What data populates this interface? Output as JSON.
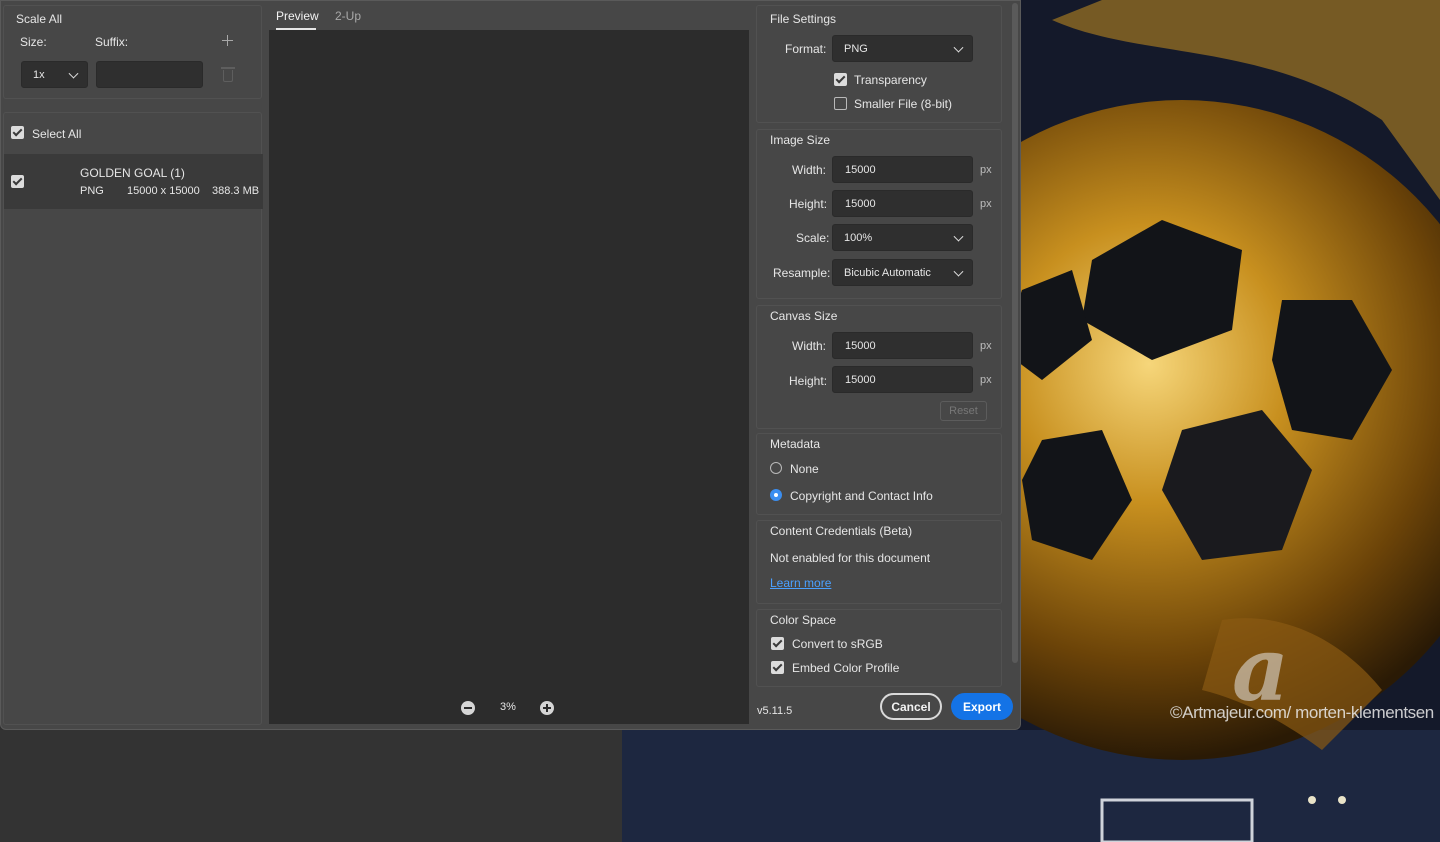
{
  "left": {
    "scale_all_label": "Scale All",
    "size_label": "Size:",
    "suffix_label": "Suffix:",
    "size_value": "1x",
    "suffix_value": "",
    "select_all_label": "Select All",
    "file": {
      "name": "GOLDEN GOAL (1)",
      "format": "PNG",
      "dimensions": "15000 x 15000",
      "size": "388.3 MB"
    }
  },
  "preview": {
    "tabs": [
      "Preview",
      "2-Up"
    ],
    "zoom": "3%"
  },
  "settings": {
    "file_settings": {
      "title": "File Settings",
      "format_label": "Format:",
      "format_value": "PNG",
      "transparency_label": "Transparency",
      "smaller_file_label": "Smaller File (8-bit)"
    },
    "image_size": {
      "title": "Image Size",
      "width_label": "Width:",
      "width_value": "15000",
      "height_label": "Height:",
      "height_value": "15000",
      "scale_label": "Scale:",
      "scale_value": "100%",
      "resample_label": "Resample:",
      "resample_value": "Bicubic Automatic",
      "unit": "px"
    },
    "canvas_size": {
      "title": "Canvas Size",
      "width_label": "Width:",
      "width_value": "15000",
      "height_label": "Height:",
      "height_value": "15000",
      "unit": "px",
      "reset_label": "Reset"
    },
    "metadata": {
      "title": "Metadata",
      "option_none": "None",
      "option_copyright": "Copyright and Contact Info"
    },
    "content_credentials": {
      "title": "Content Credentials (Beta)",
      "status": "Not enabled for this document",
      "learn_more": "Learn more"
    },
    "color_space": {
      "title": "Color Space",
      "convert_label": "Convert to sRGB",
      "embed_label": "Embed Color Profile"
    }
  },
  "footer": {
    "version": "v5.11.5",
    "cancel_label": "Cancel",
    "export_label": "Export"
  },
  "background": {
    "watermark": "©Artmajeur.com/ morten-klementsen"
  },
  "colors": {
    "accent": "#1473e6",
    "link": "#4aa0ff",
    "dialog_bg": "#474747",
    "preview_bg": "#2c2c2c"
  }
}
